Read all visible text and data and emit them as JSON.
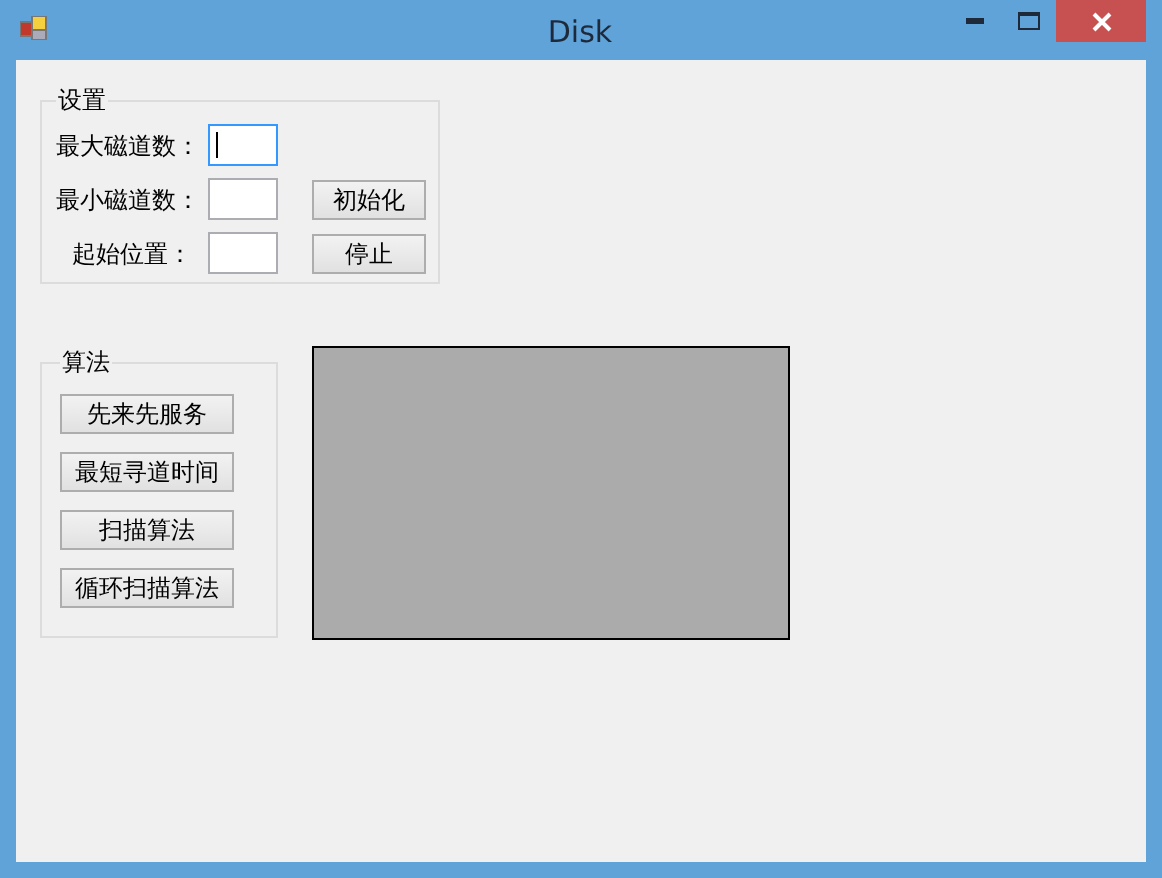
{
  "window": {
    "title": "Disk"
  },
  "settings": {
    "title": "设置",
    "fields": [
      {
        "label": "最大磁道数：",
        "focused": true
      },
      {
        "label": "最小磁道数：",
        "focused": false
      },
      {
        "label": "起始位置：",
        "focused": false
      }
    ],
    "buttons": [
      "初始化",
      "停止"
    ]
  },
  "algorithm": {
    "title": "算法",
    "buttons": [
      "先来先服务",
      "最短寻道时间",
      "扫描算法",
      "循环扫描算法"
    ]
  }
}
